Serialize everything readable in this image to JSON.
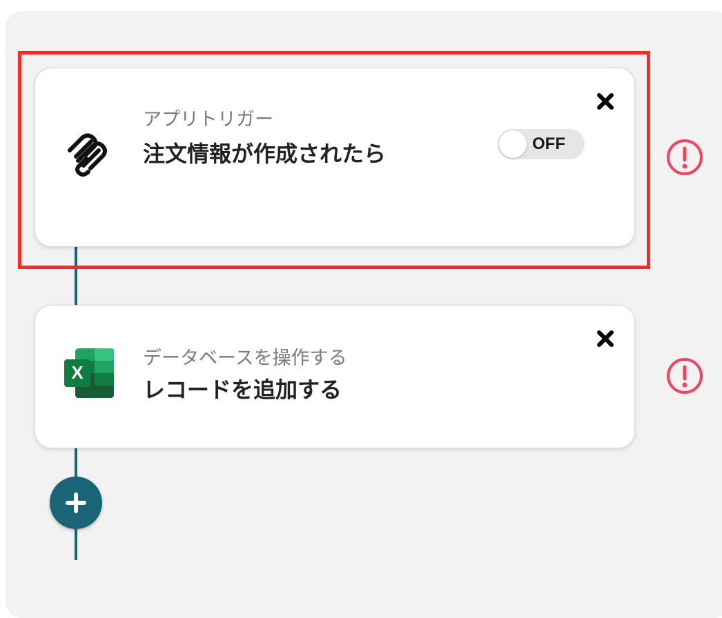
{
  "flow": {
    "steps": [
      {
        "subtitle": "アプリトリガー",
        "title": "注文情報が作成されたら",
        "app_icon": "squarespace-logo-icon",
        "toggle_label": "OFF",
        "toggle_state": "off",
        "close_icon": "close-icon",
        "warning_icon": "exclamation-circle-icon"
      },
      {
        "subtitle": "データベースを操作する",
        "title": "レコードを追加する",
        "app_icon": "excel-logo-icon",
        "close_icon": "close-icon",
        "warning_icon": "exclamation-circle-icon"
      }
    ],
    "add_step_icon": "plus-icon"
  },
  "colors": {
    "canvas_bg": "#f2f2f2",
    "connector": "#1a6478",
    "add_button": "#1a6478",
    "warning": "#f1435f",
    "highlight": "#fb2a22",
    "toggle_track": "#e6e6e6"
  }
}
